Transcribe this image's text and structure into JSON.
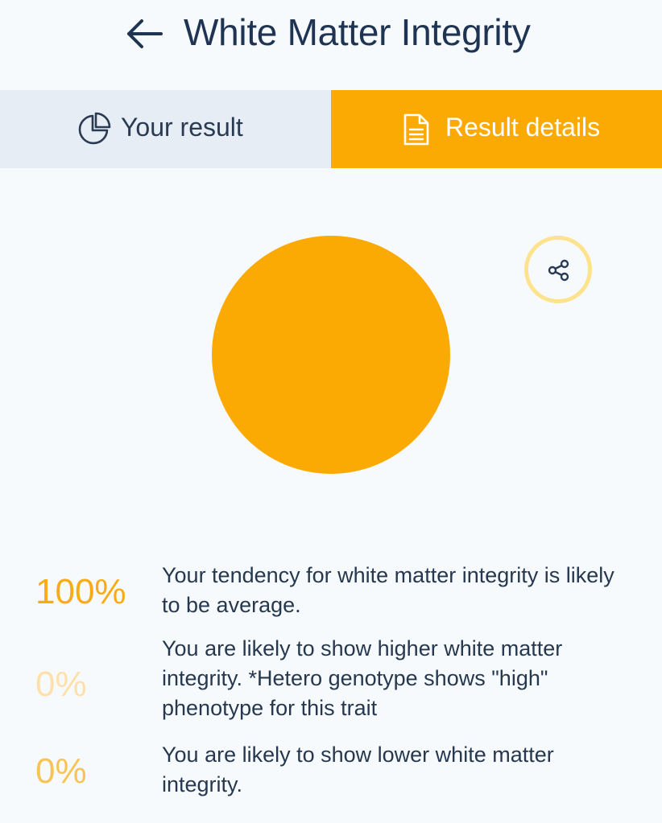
{
  "header": {
    "title": "White Matter Integrity",
    "back_icon": "arrow-left-icon"
  },
  "tabs": [
    {
      "label": "Your result",
      "icon": "pie-chart-icon",
      "active": false
    },
    {
      "label": "Result details",
      "icon": "document-icon",
      "active": true
    }
  ],
  "share": {
    "icon": "share-icon"
  },
  "colors": {
    "accent": "#fbaa04",
    "tab_inactive_bg": "#e6edf5",
    "text": "#253650",
    "share_ring": "#fde38d"
  },
  "chart_data": {
    "type": "pie",
    "title": "",
    "categories": [
      "average",
      "higher",
      "lower"
    ],
    "values": [
      100,
      0,
      0
    ],
    "colors": [
      "#fbaa04",
      "#fde0aa",
      "#f6c455"
    ]
  },
  "results": [
    {
      "percent": "100%",
      "text": "Your tendency for white matter integrity is likely to be average."
    },
    {
      "percent": "0%",
      "text": "You are likely to show higher white matter integrity. *Hetero genotype shows \"high\" phenotype for this trait"
    },
    {
      "percent": "0%",
      "text": "You are likely to show lower white matter integrity."
    }
  ]
}
